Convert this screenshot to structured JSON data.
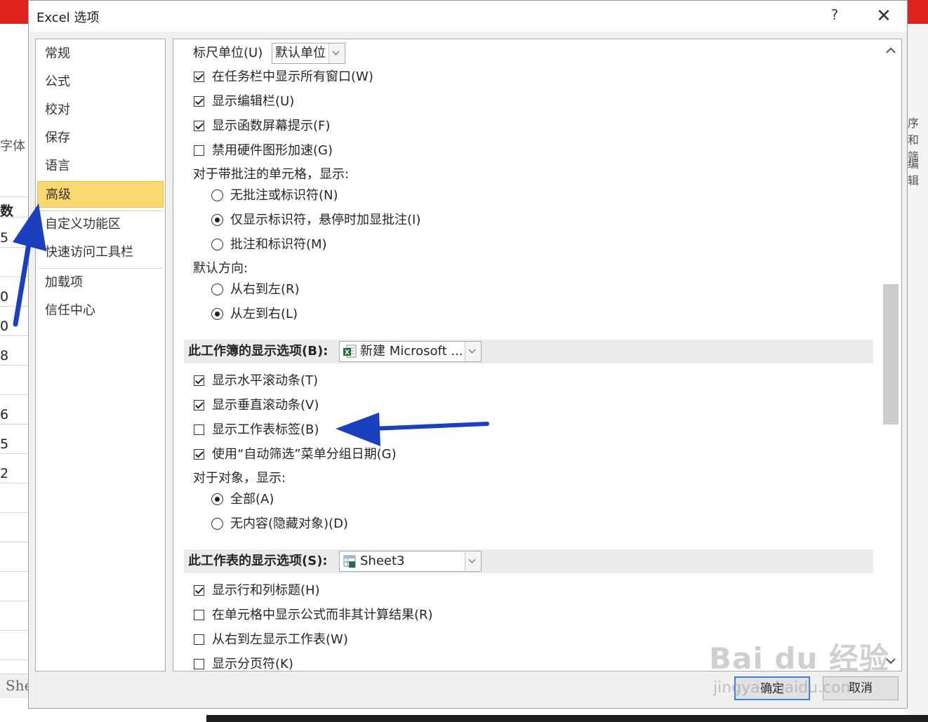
{
  "background": {
    "row_labels": [
      "数",
      "5",
      "0",
      "0",
      "8",
      "6",
      "5",
      "2"
    ],
    "left_texts": [
      "字体"
    ],
    "right_texts": [
      "序和筛",
      "编辑"
    ],
    "sheet_tab": "She"
  },
  "dialog": {
    "title": "Excel 选项",
    "help_label": "?",
    "close_label": "✕"
  },
  "nav": {
    "items": [
      {
        "label": "常规"
      },
      {
        "label": "公式"
      },
      {
        "label": "校对"
      },
      {
        "label": "保存"
      },
      {
        "label": "语言"
      },
      {
        "label": "高级",
        "selected": true
      },
      {
        "label": "自定义功能区"
      },
      {
        "label": "快速访问工具栏"
      },
      {
        "label": "加载项"
      },
      {
        "label": "信任中心"
      }
    ]
  },
  "content": {
    "ruler": {
      "label": "标尺单位(U)",
      "value": "默认单位"
    },
    "taskbar": {
      "label": "在任务栏中显示所有窗口(W)",
      "checked": true
    },
    "formula_bar": {
      "label": "显示编辑栏(U)",
      "checked": true
    },
    "screen_tips": {
      "label": "显示函数屏幕提示(F)",
      "checked": true
    },
    "hw_accel": {
      "label": "禁用硬件图形加速(G)",
      "checked": false
    },
    "comments_heading": "对于带批注的单元格，显示:",
    "comments_none": {
      "label": "无批注或标识符(N)",
      "checked": false
    },
    "comments_indicator": {
      "label": "仅显示标识符，悬停时加显批注(I)",
      "checked": true
    },
    "comments_both": {
      "label": "批注和标识符(M)",
      "checked": false
    },
    "direction_heading": "默认方向:",
    "dir_rtl": {
      "label": "从右到左(R)",
      "checked": false
    },
    "dir_ltr": {
      "label": "从左到右(L)",
      "checked": true
    },
    "workbook_section": {
      "label": "此工作簿的显示选项(B):",
      "value": "新建 Microsoft ..."
    },
    "h_scroll": {
      "label": "显示水平滚动条(T)",
      "checked": true
    },
    "v_scroll": {
      "label": "显示垂直滚动条(V)",
      "checked": true
    },
    "sheet_tabs": {
      "label": "显示工作表标签(B)",
      "checked": false
    },
    "group_dates": {
      "label": "使用“自动筛选”菜单分组日期(G)",
      "checked": true
    },
    "objects_heading": "对于对象，显示:",
    "obj_all": {
      "label": "全部(A)",
      "checked": true
    },
    "obj_none": {
      "label": "无内容(隐藏对象)(D)",
      "checked": false
    },
    "sheet_section": {
      "label": "此工作表的显示选项(S):",
      "value": "Sheet3"
    },
    "row_col_headers": {
      "label": "显示行和列标题(H)",
      "checked": true
    },
    "show_formulas": {
      "label": "在单元格中显示公式而非其计算结果(R)",
      "checked": false
    },
    "rtl_sheet": {
      "label": "从右到左显示工作表(W)",
      "checked": false
    },
    "page_breaks": {
      "label": "显示分页符(K)",
      "checked": false
    }
  },
  "buttons": {
    "ok": "确定",
    "cancel": "取消"
  },
  "watermark": {
    "brand": "Bai du 经验",
    "url": "jingyan.baidu.com"
  },
  "colors": {
    "selected_nav": "#fcd870",
    "annotation_arrow": "#1a3fbf",
    "excel_red": "#e0201b"
  }
}
